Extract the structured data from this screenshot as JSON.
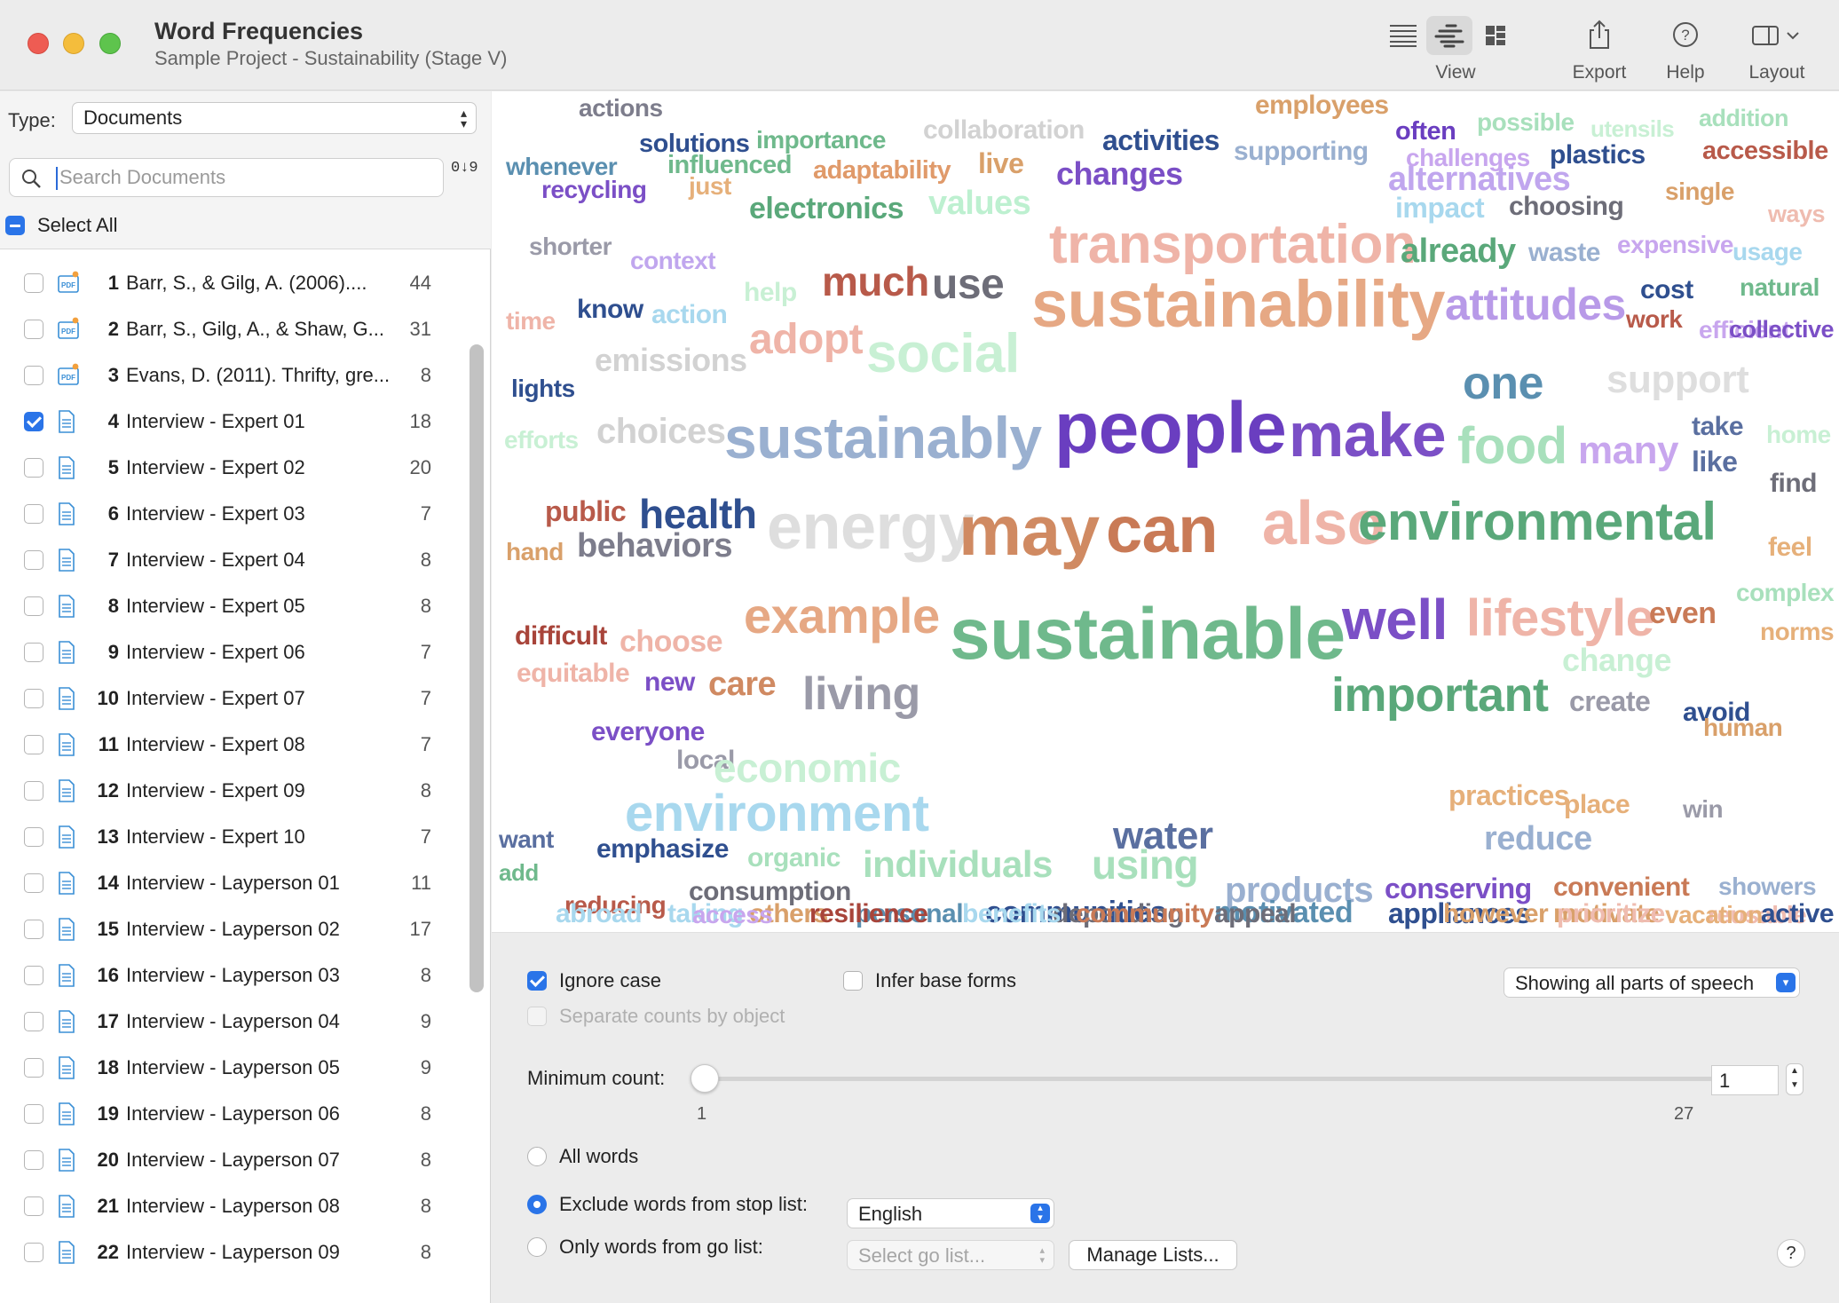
{
  "window": {
    "title": "Word Frequencies",
    "subtitle": "Sample Project - Sustainability (Stage V)"
  },
  "toolbar": {
    "view_label": "View",
    "export_label": "Export",
    "help_label": "Help",
    "layout_label": "Layout",
    "view_modes": [
      "list-view-icon",
      "word-cloud-view-icon",
      "treemap-view-icon"
    ],
    "active_view": "word-cloud-view-icon"
  },
  "sidebar": {
    "type_label": "Type:",
    "type_value": "Documents",
    "search_placeholder": "Search Documents",
    "sort_label": "0↓9",
    "select_all_label": "Select All",
    "documents": [
      {
        "num": "1",
        "name": "Barr, S., & Gilg, A. (2006)....",
        "count": "44",
        "kind": "pdf",
        "checked": false
      },
      {
        "num": "2",
        "name": "Barr, S., Gilg, A., & Shaw, G...",
        "count": "31",
        "kind": "pdf",
        "checked": false
      },
      {
        "num": "3",
        "name": "Evans, D. (2011). Thrifty, gre...",
        "count": "8",
        "kind": "pdf",
        "checked": false
      },
      {
        "num": "4",
        "name": "Interview - Expert 01",
        "count": "18",
        "kind": "text",
        "checked": true
      },
      {
        "num": "5",
        "name": "Interview - Expert 02",
        "count": "20",
        "kind": "text",
        "checked": false
      },
      {
        "num": "6",
        "name": "Interview - Expert 03",
        "count": "7",
        "kind": "text",
        "checked": false
      },
      {
        "num": "7",
        "name": "Interview - Expert 04",
        "count": "8",
        "kind": "text",
        "checked": false
      },
      {
        "num": "8",
        "name": "Interview - Expert 05",
        "count": "8",
        "kind": "text",
        "checked": false
      },
      {
        "num": "9",
        "name": "Interview - Expert 06",
        "count": "7",
        "kind": "text",
        "checked": false
      },
      {
        "num": "10",
        "name": "Interview - Expert 07",
        "count": "7",
        "kind": "text",
        "checked": false
      },
      {
        "num": "11",
        "name": "Interview - Expert 08",
        "count": "7",
        "kind": "text",
        "checked": false
      },
      {
        "num": "12",
        "name": "Interview - Expert 09",
        "count": "8",
        "kind": "text",
        "checked": false
      },
      {
        "num": "13",
        "name": "Interview - Expert 10",
        "count": "7",
        "kind": "text",
        "checked": false
      },
      {
        "num": "14",
        "name": "Interview - Layperson 01",
        "count": "11",
        "kind": "text",
        "checked": false
      },
      {
        "num": "15",
        "name": "Interview - Layperson 02",
        "count": "17",
        "kind": "text",
        "checked": false
      },
      {
        "num": "16",
        "name": "Interview - Layperson 03",
        "count": "8",
        "kind": "text",
        "checked": false
      },
      {
        "num": "17",
        "name": "Interview - Layperson 04",
        "count": "9",
        "kind": "text",
        "checked": false
      },
      {
        "num": "18",
        "name": "Interview - Layperson 05",
        "count": "9",
        "kind": "text",
        "checked": false
      },
      {
        "num": "19",
        "name": "Interview - Layperson 06",
        "count": "8",
        "kind": "text",
        "checked": false
      },
      {
        "num": "20",
        "name": "Interview - Layperson 07",
        "count": "8",
        "kind": "text",
        "checked": false
      },
      {
        "num": "21",
        "name": "Interview - Layperson 08",
        "count": "8",
        "kind": "text",
        "checked": false
      },
      {
        "num": "22",
        "name": "Interview - Layperson 09",
        "count": "8",
        "kind": "text",
        "checked": false
      }
    ]
  },
  "word_cloud": {
    "words": [
      {
        "text": "actions",
        "color": "#7d7d8c"
      },
      {
        "text": "solutions",
        "color": "#2f4f8f"
      },
      {
        "text": "importance",
        "color": "#6fb98c"
      },
      {
        "text": "collaboration",
        "color": "#d2d2d2"
      },
      {
        "text": "activities",
        "color": "#2f4f8f"
      },
      {
        "text": "employees",
        "color": "#d9a06a"
      },
      {
        "text": "often",
        "color": "#6a3ec0"
      },
      {
        "text": "possible",
        "color": "#a8e0bc"
      },
      {
        "text": "utensils",
        "color": "#c8f0d4"
      },
      {
        "text": "addition",
        "color": "#a8e0bc"
      },
      {
        "text": "whenever",
        "color": "#5a8fb0"
      },
      {
        "text": "influenced",
        "color": "#6fb98c"
      },
      {
        "text": "adaptability",
        "color": "#e09a6a"
      },
      {
        "text": "live",
        "color": "#d9a06a"
      },
      {
        "text": "changes",
        "color": "#7b4fc6"
      },
      {
        "text": "supporting",
        "color": "#9ab0d0"
      },
      {
        "text": "alternatives",
        "color": "#c0a6ee"
      },
      {
        "text": "challenges",
        "color": "#c8a6ee"
      },
      {
        "text": "plastics",
        "color": "#2f4f8f"
      },
      {
        "text": "accessible",
        "color": "#b85a4a"
      },
      {
        "text": "recycling",
        "color": "#7b4fc6"
      },
      {
        "text": "just",
        "color": "#e6b07a"
      },
      {
        "text": "electronics",
        "color": "#5aa87a"
      },
      {
        "text": "values",
        "color": "#bdf0d0"
      },
      {
        "text": "transportation",
        "color": "#efb4a8"
      },
      {
        "text": "impact",
        "color": "#a8d8ee"
      },
      {
        "text": "choosing",
        "color": "#6d6d78"
      },
      {
        "text": "single",
        "color": "#d9a06a"
      },
      {
        "text": "ways",
        "color": "#efbcb0"
      },
      {
        "text": "shorter",
        "color": "#9a9aa8"
      },
      {
        "text": "context",
        "color": "#c0a6ee"
      },
      {
        "text": "already",
        "color": "#5aa87a"
      },
      {
        "text": "waste",
        "color": "#9ab0d0"
      },
      {
        "text": "expensive",
        "color": "#c8a6ee"
      },
      {
        "text": "usage",
        "color": "#a8d8ee"
      },
      {
        "text": "time",
        "color": "#efb4a8"
      },
      {
        "text": "know",
        "color": "#2f4f8f"
      },
      {
        "text": "action",
        "color": "#a8d8ee"
      },
      {
        "text": "help",
        "color": "#c8f0d4"
      },
      {
        "text": "much",
        "color": "#b85a4a"
      },
      {
        "text": "use",
        "color": "#6d6d78"
      },
      {
        "text": "sustainability",
        "color": "#e6a884"
      },
      {
        "text": "attitudes",
        "color": "#b89ae8"
      },
      {
        "text": "cost",
        "color": "#2f4f8f"
      },
      {
        "text": "natural",
        "color": "#6fb98c"
      },
      {
        "text": "work",
        "color": "#b85a4a"
      },
      {
        "text": "efficient",
        "color": "#c8a6ee"
      },
      {
        "text": "emissions",
        "color": "#d2d2d2"
      },
      {
        "text": "adopt",
        "color": "#efb4a8"
      },
      {
        "text": "social",
        "color": "#c8f0d4"
      },
      {
        "text": "one",
        "color": "#5a8fb0"
      },
      {
        "text": "support",
        "color": "#dedede"
      },
      {
        "text": "collective",
        "color": "#7b4fc6"
      },
      {
        "text": "lights",
        "color": "#2f4f8f"
      },
      {
        "text": "efforts",
        "color": "#c8f0d4"
      },
      {
        "text": "choices",
        "color": "#d2d2d2"
      },
      {
        "text": "sustainably",
        "color": "#9ab0d0"
      },
      {
        "text": "people",
        "color": "#6a3ec0"
      },
      {
        "text": "make",
        "color": "#7b4fc6"
      },
      {
        "text": "food",
        "color": "#a8e0bc"
      },
      {
        "text": "many",
        "color": "#c8a6ee"
      },
      {
        "text": "take",
        "color": "#5a6fa0"
      },
      {
        "text": "home",
        "color": "#c8f0d4"
      },
      {
        "text": "like",
        "color": "#5a6fa0"
      },
      {
        "text": "find",
        "color": "#6d6d78"
      },
      {
        "text": "public",
        "color": "#b85a4a"
      },
      {
        "text": "health",
        "color": "#2f4f8f"
      },
      {
        "text": "energy",
        "color": "#dedede"
      },
      {
        "text": "may",
        "color": "#d08a62"
      },
      {
        "text": "can",
        "color": "#c97a56"
      },
      {
        "text": "also",
        "color": "#efb4a8"
      },
      {
        "text": "environmental",
        "color": "#5aa87a"
      },
      {
        "text": "feel",
        "color": "#e6b07a"
      },
      {
        "text": "hand",
        "color": "#d9a06a"
      },
      {
        "text": "behaviors",
        "color": "#7d7d8c"
      },
      {
        "text": "complex",
        "color": "#a8e0bc"
      },
      {
        "text": "example",
        "color": "#e6a884"
      },
      {
        "text": "lifestyle",
        "color": "#efb4a8"
      },
      {
        "text": "even",
        "color": "#c97a56"
      },
      {
        "text": "norms",
        "color": "#e6b07a"
      },
      {
        "text": "difficult",
        "color": "#a8443a"
      },
      {
        "text": "choose",
        "color": "#efb4a8"
      },
      {
        "text": "sustainable",
        "color": "#6fb98c"
      },
      {
        "text": "well",
        "color": "#7b4fc6"
      },
      {
        "text": "change",
        "color": "#c8f0d4"
      },
      {
        "text": "equitable",
        "color": "#efb4a8"
      },
      {
        "text": "new",
        "color": "#7b4fc6"
      },
      {
        "text": "care",
        "color": "#d08a62"
      },
      {
        "text": "living",
        "color": "#9a9aa8"
      },
      {
        "text": "important",
        "color": "#5aa87a"
      },
      {
        "text": "create",
        "color": "#9a9aa8"
      },
      {
        "text": "avoid",
        "color": "#2f4f8f"
      },
      {
        "text": "human",
        "color": "#d9a06a"
      },
      {
        "text": "everyone",
        "color": "#7b4fc6"
      },
      {
        "text": "local",
        "color": "#9a9aa8"
      },
      {
        "text": "economic",
        "color": "#c8f0d4"
      },
      {
        "text": "environment",
        "color": "#a8d8ee"
      },
      {
        "text": "practices",
        "color": "#e6b07a"
      },
      {
        "text": "place",
        "color": "#e6b07a"
      },
      {
        "text": "win",
        "color": "#9a9aa8"
      },
      {
        "text": "want",
        "color": "#5a6fa0"
      },
      {
        "text": "emphasize",
        "color": "#2f4f8f"
      },
      {
        "text": "organic",
        "color": "#a8e0bc"
      },
      {
        "text": "water",
        "color": "#5a6fa0"
      },
      {
        "text": "reduce",
        "color": "#9ab0d0"
      },
      {
        "text": "individuals",
        "color": "#a8e0bc"
      },
      {
        "text": "using",
        "color": "#a8e0bc"
      },
      {
        "text": "products",
        "color": "#9ab0d0"
      },
      {
        "text": "conserving",
        "color": "#7b4fc6"
      },
      {
        "text": "convenient",
        "color": "#c97a56"
      },
      {
        "text": "showers",
        "color": "#9ab0d0"
      },
      {
        "text": "add",
        "color": "#6fb98c"
      },
      {
        "text": "reducing",
        "color": "#b85a4a"
      },
      {
        "text": "consumption",
        "color": "#6d6d78"
      },
      {
        "text": "personal",
        "color": "#5a8fb0"
      },
      {
        "text": "communities",
        "color": "#2f4f8f"
      },
      {
        "text": "motivated",
        "color": "#5a8fb0"
      },
      {
        "text": "appliances",
        "color": "#2f4f8f"
      },
      {
        "text": "motivate",
        "color": "#d9a06a"
      },
      {
        "text": "reusable",
        "color": "#efbcb0"
      },
      {
        "text": "abroad",
        "color": "#a8d8ee"
      },
      {
        "text": "taking",
        "color": "#a8d8ee"
      },
      {
        "text": "others",
        "color": "#d9a06a"
      },
      {
        "text": "depending",
        "color": "#6d6d78"
      },
      {
        "text": "appeal",
        "color": "#6d6d78"
      },
      {
        "text": "however",
        "color": "#d9a06a"
      },
      {
        "text": "prioritize",
        "color": "#efbcb0"
      },
      {
        "text": "vacation",
        "color": "#e6b07a"
      },
      {
        "text": "active",
        "color": "#2f4f8f"
      },
      {
        "text": "access",
        "color": "#c8a6ee"
      },
      {
        "text": "resilience",
        "color": "#a8443a"
      },
      {
        "text": "benefits",
        "color": "#a8d8ee"
      },
      {
        "text": "community",
        "color": "#c97a56"
      }
    ]
  },
  "options": {
    "ignore_case_label": "Ignore case",
    "ignore_case_checked": true,
    "infer_base_label": "Infer base forms",
    "infer_base_checked": false,
    "separate_counts_label": "Separate counts by object",
    "parts_of_speech_value": "Showing all parts of speech",
    "min_count_label": "Minimum count:",
    "min_count_value": "1",
    "slider_min": "1",
    "slider_max": "27",
    "all_words_label": "All words",
    "exclude_label": "Exclude words from stop list:",
    "only_go_label": "Only words from go list:",
    "selected_filter": "exclude",
    "stop_list_value": "English",
    "go_list_placeholder": "Select go list...",
    "manage_lists_label": "Manage Lists...",
    "help_label": "?"
  }
}
